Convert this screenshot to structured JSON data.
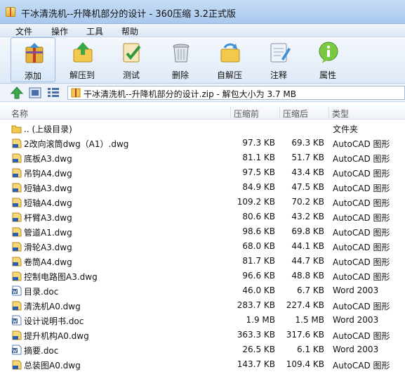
{
  "window": {
    "title": "干冰清洗机--升降机部分的设计 - 360压缩 3.2正式版"
  },
  "menu": [
    "文件",
    "操作",
    "工具",
    "帮助"
  ],
  "toolbar": [
    {
      "label": "添加",
      "icon": "add-archive-icon",
      "active": true
    },
    {
      "label": "解压到",
      "icon": "extract-icon"
    },
    {
      "label": "测试",
      "icon": "test-icon"
    },
    {
      "label": "删除",
      "icon": "delete-icon"
    },
    {
      "label": "自解压",
      "icon": "self-extract-icon"
    },
    {
      "label": "注释",
      "icon": "comment-icon"
    },
    {
      "label": "属性",
      "icon": "info-icon"
    }
  ],
  "address": {
    "text": "干冰清洗机--升降机部分的设计.zip - 解包大小为 3.7 MB"
  },
  "columns": {
    "name": "名称",
    "size": "压缩前",
    "packed": "压缩后",
    "type": "类型"
  },
  "files": [
    {
      "name": ".. (上级目录)",
      "size": "",
      "packed": "",
      "type": "文件夹",
      "icon": "folder-icon"
    },
    {
      "name": "2改向滚筒dwg（A1）.dwg",
      "size": "97.3 KB",
      "packed": "69.3 KB",
      "type": "AutoCAD 图形",
      "icon": "dwg-icon"
    },
    {
      "name": "底板A3.dwg",
      "size": "81.1 KB",
      "packed": "51.7 KB",
      "type": "AutoCAD 图形",
      "icon": "dwg-icon"
    },
    {
      "name": "吊钩A4.dwg",
      "size": "97.5 KB",
      "packed": "43.4 KB",
      "type": "AutoCAD 图形",
      "icon": "dwg-icon"
    },
    {
      "name": "短轴A3.dwg",
      "size": "84.9 KB",
      "packed": "47.5 KB",
      "type": "AutoCAD 图形",
      "icon": "dwg-icon"
    },
    {
      "name": "短轴A4.dwg",
      "size": "109.2 KB",
      "packed": "70.2 KB",
      "type": "AutoCAD 图形",
      "icon": "dwg-icon"
    },
    {
      "name": "杆臂A3.dwg",
      "size": "80.6 KB",
      "packed": "43.2 KB",
      "type": "AutoCAD 图形",
      "icon": "dwg-icon"
    },
    {
      "name": "管道A1.dwg",
      "size": "98.6 KB",
      "packed": "69.8 KB",
      "type": "AutoCAD 图形",
      "icon": "dwg-icon"
    },
    {
      "name": "滑轮A3.dwg",
      "size": "68.0 KB",
      "packed": "44.1 KB",
      "type": "AutoCAD 图形",
      "icon": "dwg-icon"
    },
    {
      "name": "卷筒A4.dwg",
      "size": "81.7 KB",
      "packed": "44.7 KB",
      "type": "AutoCAD 图形",
      "icon": "dwg-icon"
    },
    {
      "name": "控制电路图A3.dwg",
      "size": "96.6 KB",
      "packed": "48.8 KB",
      "type": "AutoCAD 图形",
      "icon": "dwg-icon"
    },
    {
      "name": "目录.doc",
      "size": "46.0 KB",
      "packed": "6.7 KB",
      "type": "Word 2003",
      "icon": "doc-icon"
    },
    {
      "name": "清洗机A0.dwg",
      "size": "283.7 KB",
      "packed": "227.4 KB",
      "type": "AutoCAD 图形",
      "icon": "dwg-icon"
    },
    {
      "name": "设计说明书.doc",
      "size": "1.9 MB",
      "packed": "1.5 MB",
      "type": "Word 2003",
      "icon": "doc-icon"
    },
    {
      "name": "提升机构A0.dwg",
      "size": "363.3 KB",
      "packed": "317.6 KB",
      "type": "AutoCAD 图形",
      "icon": "dwg-icon"
    },
    {
      "name": "摘要.doc",
      "size": "26.5 KB",
      "packed": "6.1 KB",
      "type": "Word 2003",
      "icon": "doc-icon"
    },
    {
      "name": "总装图A0.dwg",
      "size": "143.7 KB",
      "packed": "109.4 KB",
      "type": "AutoCAD 图形",
      "icon": "dwg-icon"
    }
  ]
}
